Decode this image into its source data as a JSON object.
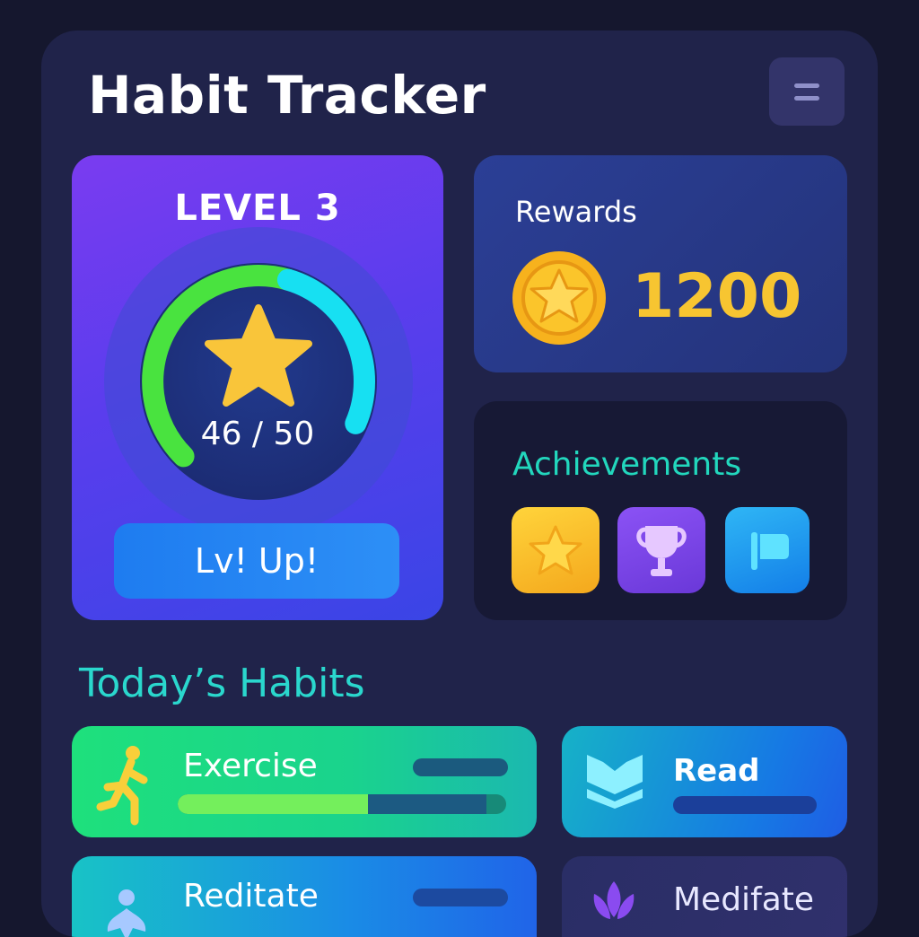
{
  "app": {
    "title": "Habit Tracker"
  },
  "level": {
    "label": "LEVEL 3",
    "progress_text": "46 / 50",
    "progress": {
      "current": 46,
      "max": 50
    },
    "button_label": "Lv! Up!"
  },
  "rewards": {
    "label": "Rewards",
    "value": "1200"
  },
  "achievements": {
    "title": "Achievements",
    "badges": [
      "star-badge-icon",
      "trophy-badge-icon",
      "flag-badge-icon"
    ]
  },
  "habits": {
    "section_title": "Today’s Habits",
    "items": [
      {
        "name": "Exercise",
        "icon": "running-icon",
        "progress": 0.58
      },
      {
        "name": "Read",
        "icon": "book-icon",
        "progress": 0
      },
      {
        "name": "Reditate",
        "icon": "meditation-icon",
        "progress": 0
      },
      {
        "name": "Medifate",
        "icon": "lotus-icon",
        "progress": 0
      }
    ]
  },
  "colors": {
    "background": "#15172e",
    "panel": "#20234a",
    "accent_teal": "#2ad7cd",
    "gold": "#f7c531",
    "ring_green": "#49e33f",
    "ring_cyan": "#17e0f2"
  }
}
